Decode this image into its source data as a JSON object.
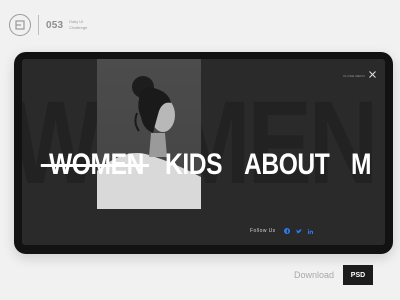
{
  "brand": {
    "number": "053",
    "subtitle_line1": "Daily UI",
    "subtitle_line2": "Challenge"
  },
  "screen": {
    "background_word": "WOMEN",
    "close_label": "CLOSE MENU",
    "close_icon": "close-icon",
    "nav_items": [
      {
        "label": "WOMEN",
        "struck": true
      },
      {
        "label": "KIDS"
      },
      {
        "label": "ABOUT"
      },
      {
        "label": "M"
      }
    ],
    "follow": {
      "label": "Follow Us",
      "icons": [
        "facebook-icon",
        "twitter-icon",
        "linkedin-icon"
      ]
    }
  },
  "footer": {
    "download_label": "Download",
    "psd_label": "PSD"
  },
  "colors": {
    "page_bg": "#f1f1f1",
    "device": "#121212",
    "screen_bg": "#2a2a2a",
    "nav_text": "#ffffff",
    "accent_blue": "#2d7df0"
  }
}
